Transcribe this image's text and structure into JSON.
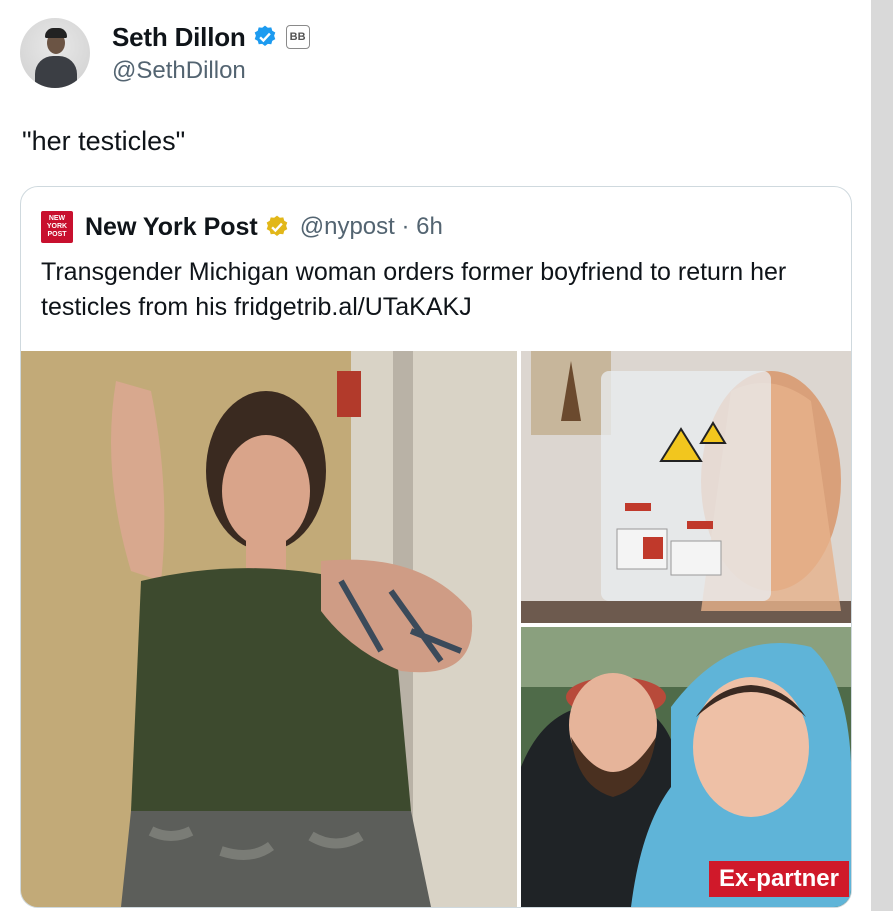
{
  "tweet": {
    "author": {
      "display_name": "Seth Dillon",
      "handle": "@SethDillon",
      "verified_color": "#1d9bf0",
      "affiliate_badge": "BB"
    },
    "text": "\"her testicles\""
  },
  "quoted": {
    "logo_text": "NEW YORK POST",
    "display_name": "New York Post",
    "verified_color": "#e2b719",
    "meta": "@nypost · 6h",
    "text": "Transgender Michigan woman orders former boyfriend to return her testicles from his fridgetrib.al/UTaKAKJ",
    "images": [
      {
        "name": "main-photo"
      },
      {
        "name": "bag-photo"
      },
      {
        "name": "couple-photo",
        "label": "Ex-partner"
      }
    ]
  },
  "colors": {
    "brand_red": "#c8102e",
    "label_red": "#d0192a"
  }
}
